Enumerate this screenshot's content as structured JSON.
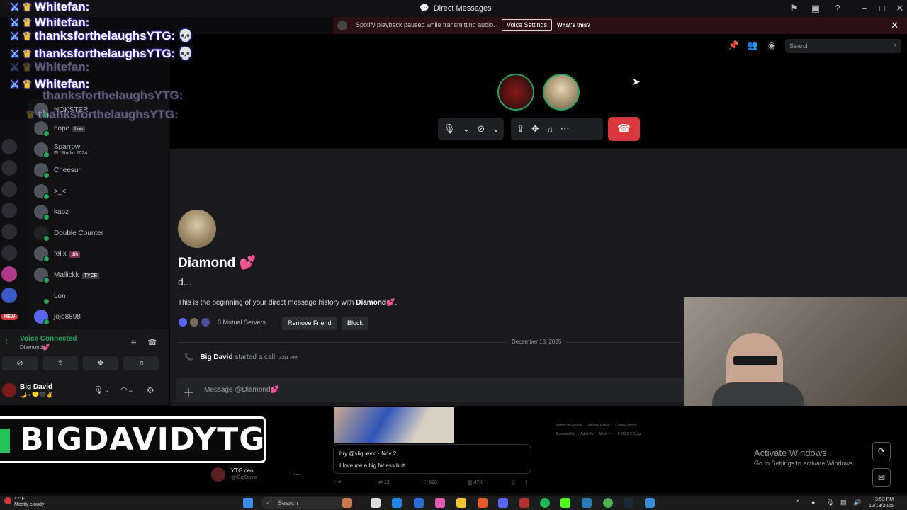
{
  "window": {
    "title": "Direct Messages"
  },
  "notice": {
    "message": "Spotify playback paused while transmitting audio.",
    "button": "Voice Settings",
    "link": "What's this?"
  },
  "overlay": {
    "lines": [
      {
        "user": "Whitefan:",
        "text": ""
      },
      {
        "user": "Whitefan:",
        "text": ""
      },
      {
        "user": "thanksforthelaughsYTG:",
        "text": ""
      },
      {
        "user": "thanksforthelaughsYTG:",
        "text": ""
      },
      {
        "user": "Whitefan:",
        "text": ""
      },
      {
        "user": "Whitefan:",
        "text": ""
      },
      {
        "user": "thanksforthelaughsYTG:",
        "text": ""
      },
      {
        "user": "thanksforthelaughsYTG:",
        "text": ""
      }
    ]
  },
  "dm_list": [
    {
      "name": "NOKSTER",
      "sub": ""
    },
    {
      "name": "hope",
      "tag": "bun"
    },
    {
      "name": "Sparrow",
      "sub": "FL Studio 2024"
    },
    {
      "name": "Cheesur"
    },
    {
      "name": ">_<"
    },
    {
      "name": "kapz"
    },
    {
      "name": "Double Counter"
    },
    {
      "name": "felix",
      "tag": "dih"
    },
    {
      "name": "Mallickk",
      "tag": "TYCE"
    },
    {
      "name": "Lon"
    },
    {
      "name": "jojo8898"
    }
  ],
  "voice": {
    "status": "Voice Connected",
    "channel": "Diamond💕",
    "user": "Big David",
    "user_status": "🌙 • 💛🖤✌"
  },
  "header": {
    "search_placeholder": "Search"
  },
  "profile": {
    "name": "Diamond 💕",
    "subtitle": "d...",
    "begin_prefix": "This is the beginning of your direct message history with ",
    "begin_name": "Diamond💕",
    "begin_suffix": ".",
    "mutual": "3 Mutual Servers",
    "remove_friend": "Remove Friend",
    "block": "Block"
  },
  "messages": {
    "date": "December 13, 2025",
    "call_user": "Big David",
    "call_text": "started a call.",
    "call_time": "3:51 PM"
  },
  "composer": {
    "placeholder": "Message @Diamond💕"
  },
  "banner": {
    "text": "BIGDAVIDYTG"
  },
  "tweet": {
    "author": "bry @sliquevic · Nov 2",
    "body": "I love me a big fat ass butt",
    "poster_name": "YTG ceo",
    "poster_handle": "@IBigDavid",
    "replies": "9",
    "reposts": "13",
    "likes": "628",
    "views": "47K"
  },
  "x_footer": {
    "links": [
      "Terms of Service",
      "Privacy Policy",
      "Cookie Policy",
      "Accessibility",
      "Ads info",
      "More ···",
      "© 2025 X Corp."
    ]
  },
  "windows": {
    "activate_title": "Activate Windows",
    "activate_sub": "Go to Settings to activate Windows.",
    "weather_temp": "47°F",
    "weather_desc": "Mostly cloudy",
    "search": "Search",
    "time": "3:53 PM",
    "date": "12/13/2025"
  },
  "colors": {
    "accent": "#5865f2",
    "online": "#23a55a",
    "danger": "#da373c"
  }
}
